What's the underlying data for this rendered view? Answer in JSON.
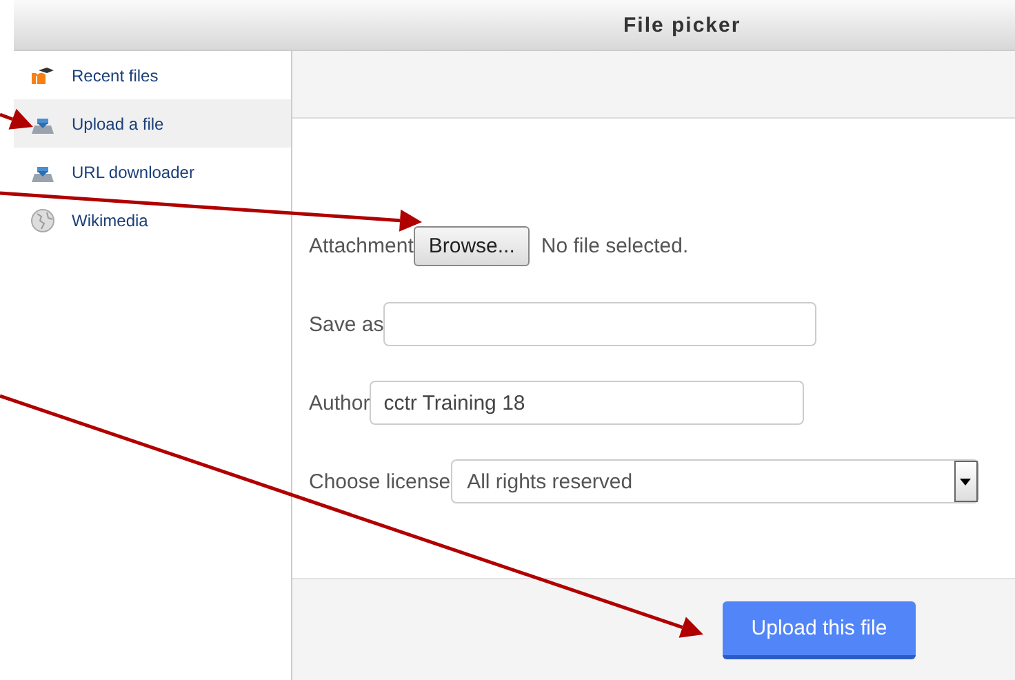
{
  "window": {
    "title": "File picker"
  },
  "sidebar": {
    "items": [
      {
        "label": "Recent files",
        "kind": "recent",
        "selected": false
      },
      {
        "label": "Upload a file",
        "kind": "upload",
        "selected": true
      },
      {
        "label": "URL downloader",
        "kind": "upload",
        "selected": false
      },
      {
        "label": "Wikimedia",
        "kind": "globe",
        "selected": false
      }
    ]
  },
  "form": {
    "attachment": {
      "label": "Attachment",
      "button": "Browse...",
      "status": "No file selected."
    },
    "save_as": {
      "label": "Save as"
    },
    "author": {
      "label": "Author",
      "value": "cctr Training 18"
    },
    "license": {
      "label": "Choose license",
      "value": "All rights reserved"
    }
  },
  "footer": {
    "button": "Upload this file"
  }
}
